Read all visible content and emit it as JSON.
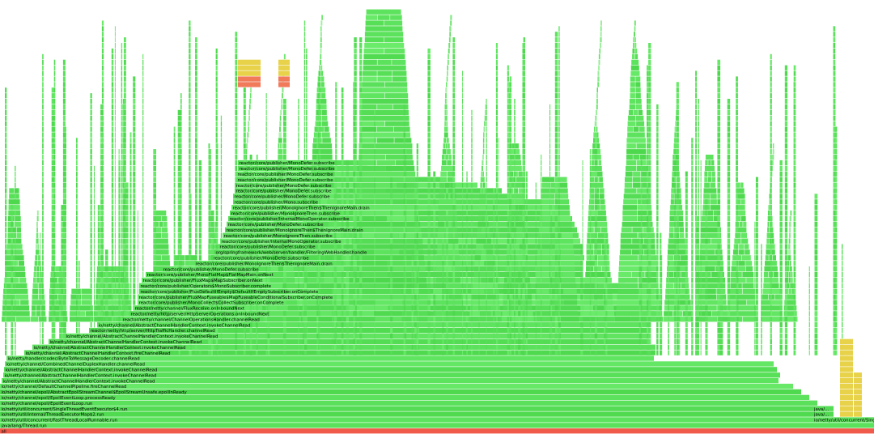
{
  "flamegraph": {
    "colors": {
      "java": "#4de14d",
      "java_alt": "#6be86b",
      "native": "#e8d24a",
      "kernel": "#f07a5a",
      "root": "#f05a4a"
    },
    "frames": [
      {
        "name": "all",
        "color": "root",
        "labeled": true
      },
      {
        "name": "java/lang/Thread.run",
        "color": "java",
        "labeled": true
      },
      {
        "name": "io/netty/util/concurrent/FastThreadLocalRunnable.run",
        "color": "java",
        "labeled": true
      },
      {
        "name": "io/netty/util/internal/ThreadExecutorMap$2.run",
        "color": "java",
        "labeled": true
      },
      {
        "name": "io/netty/util/concurrent/SingleThreadEventExecutor$4.run",
        "color": "java",
        "labeled": true
      },
      {
        "name": "io/netty/channel/epoll/EpollEventLoop.run",
        "color": "java",
        "labeled": true
      },
      {
        "name": "io/netty/channel/epoll/EpollEventLoop.processReady",
        "color": "java",
        "labeled": true
      },
      {
        "name": "io/netty/channel/epoll/AbstractEpollStreamChannel$EpollStreamUnsafe.epollInReady",
        "color": "java",
        "labeled": true
      },
      {
        "name": "io/netty/channel/DefaultChannelPipeline.fireChannelRead",
        "color": "java",
        "labeled": true
      },
      {
        "name": "io/netty/channel/AbstractChannelHandlerContext.invokeChannelRead",
        "color": "java",
        "labeled": true
      },
      {
        "name": "io/netty/channel/AbstractChannelHandlerContext.invokeChannelRead",
        "color": "java",
        "labeled": true
      },
      {
        "name": "io/netty/channel/AbstractChannelHandlerContext.invokeChannelRead",
        "color": "java",
        "labeled": true
      },
      {
        "name": "io/netty/channel/CombinedChannelDuplexHandler.channelRead",
        "color": "java",
        "labeled": true
      },
      {
        "name": "io/netty/handler/codec/ByteToMessageDecoder.channelRead",
        "color": "java",
        "labeled": true
      },
      {
        "name": "io/netty/channel/AbstractChannelHandlerContext.fireChannelRead",
        "color": "java",
        "labeled": true
      },
      {
        "name": "io/netty/channel/AbstractChannelHandlerContext.invokeChannelRead",
        "color": "java",
        "labeled": true
      },
      {
        "name": "io/netty/channel/AbstractChannelHandlerContext.invokeChannelRead",
        "color": "java",
        "labeled": true
      },
      {
        "name": "io/netty/channel/AbstractChannelHandlerContext.invokeChannelRead",
        "color": "java",
        "labeled": true
      },
      {
        "name": "reactor/netty/http/server/HttpTrafficHandler.channelRead",
        "color": "java",
        "labeled": true
      },
      {
        "name": "io/netty/channel/AbstractChannelHandlerContext.invokeChannelRead",
        "color": "java",
        "labeled": true
      },
      {
        "name": "reactor/netty/channel/ChannelOperationsHandler.channelRead",
        "color": "java",
        "labeled": true
      },
      {
        "name": "reactor/netty/http/server/HttpServerOperations.onInboundNext",
        "color": "java",
        "labeled": true
      },
      {
        "name": "reactor/netty/channel/FluxReceive.onInboundNext",
        "color": "java",
        "labeled": true
      },
      {
        "name": "reactor/core/publisher/MonoCollect$CollectSubscriber.onComplete",
        "color": "java",
        "labeled": true
      },
      {
        "name": "reactor/core/publisher/FluxMapFuseable$MapFuseableConditionalSubscriber.onComplete",
        "color": "java",
        "labeled": true
      },
      {
        "name": "reactor/core/publisher/FluxDefaultIfEmpty$DefaultIfEmptySubscriber.onComplete",
        "color": "java",
        "labeled": true
      },
      {
        "name": "reactor/core/publisher/Operators$MonoSubscriber.complete",
        "color": "java",
        "labeled": true
      },
      {
        "name": "reactor/core/publisher/FluxMap$MapSubscriber.onNext",
        "color": "java",
        "labeled": true
      },
      {
        "name": "reactor/core/publisher/MonoFlatMap$FlatMapMain.onNext",
        "color": "java",
        "labeled": true
      },
      {
        "name": "reactor/core/publisher/MonoDefer.subscribe",
        "color": "java",
        "labeled": true
      },
      {
        "name": "reactor/core/publisher/MonoIgnoreThen$ThenIgnoreMain.drain",
        "color": "java",
        "labeled": true
      },
      {
        "name": "reactor/core/publisher/MonoDefer.subscribe",
        "color": "java",
        "labeled": true
      },
      {
        "name": "org/springframework/web/server/handler/FilteringWebHandler.handle",
        "color": "java",
        "labeled": true
      },
      {
        "name": "reactor/core/publisher/MonoDefer.subscribe",
        "color": "java",
        "labeled": true
      },
      {
        "name": "reactor/core/publisher/InternalMonoOperator.subscribe",
        "color": "java",
        "labeled": true
      },
      {
        "name": "reactor/core/publisher/MonoIgnoreThen.subscribe",
        "color": "java",
        "labeled": true
      },
      {
        "name": "reactor/core/publisher/MonoIgnoreThen$ThenIgnoreMain.drain",
        "color": "java",
        "labeled": true
      },
      {
        "name": "reactor/core/publisher/MonoDefer.subscribe",
        "color": "java",
        "labeled": true
      },
      {
        "name": "reactor/core/publisher/InternalMonoOperator.subscribe",
        "color": "java",
        "labeled": true
      },
      {
        "name": "reactor/core/publisher/MonoIgnoreThen.subscribe",
        "color": "java",
        "labeled": true
      },
      {
        "name": "reactor/core/publisher/MonoIgnoreThen$ThenIgnoreMain.drain",
        "color": "java",
        "labeled": true
      },
      {
        "name": "reactor/core/publisher/Mono.subscribe",
        "color": "java",
        "labeled": true
      },
      {
        "name": "reactor/core/publisher/MonoDefer.subscribe",
        "color": "java",
        "labeled": true
      },
      {
        "name": "reactor/core/publisher/MonoDefer.subscribe",
        "color": "java",
        "labeled": true
      },
      {
        "name": "reactor/core/publisher/MonoDefer.subscribe",
        "color": "java",
        "labeled": true
      },
      {
        "name": "reactor/core/publisher/MonoDefer.subscribe",
        "color": "java",
        "labeled": true
      },
      {
        "name": "reactor/core/publisher/MonoDefer.subscribe",
        "color": "java",
        "labeled": true
      },
      {
        "name": "reactor/core/publisher/MonoDefer.subscribe",
        "color": "java",
        "labeled": true
      },
      {
        "name": "reactor/core/publisher/MonoDefer.subscribe",
        "color": "java",
        "labeled": true
      }
    ],
    "side_labels_right": [
      "io/netty/util/concurrent/SingleT...",
      "java/...",
      "java/..."
    ]
  }
}
